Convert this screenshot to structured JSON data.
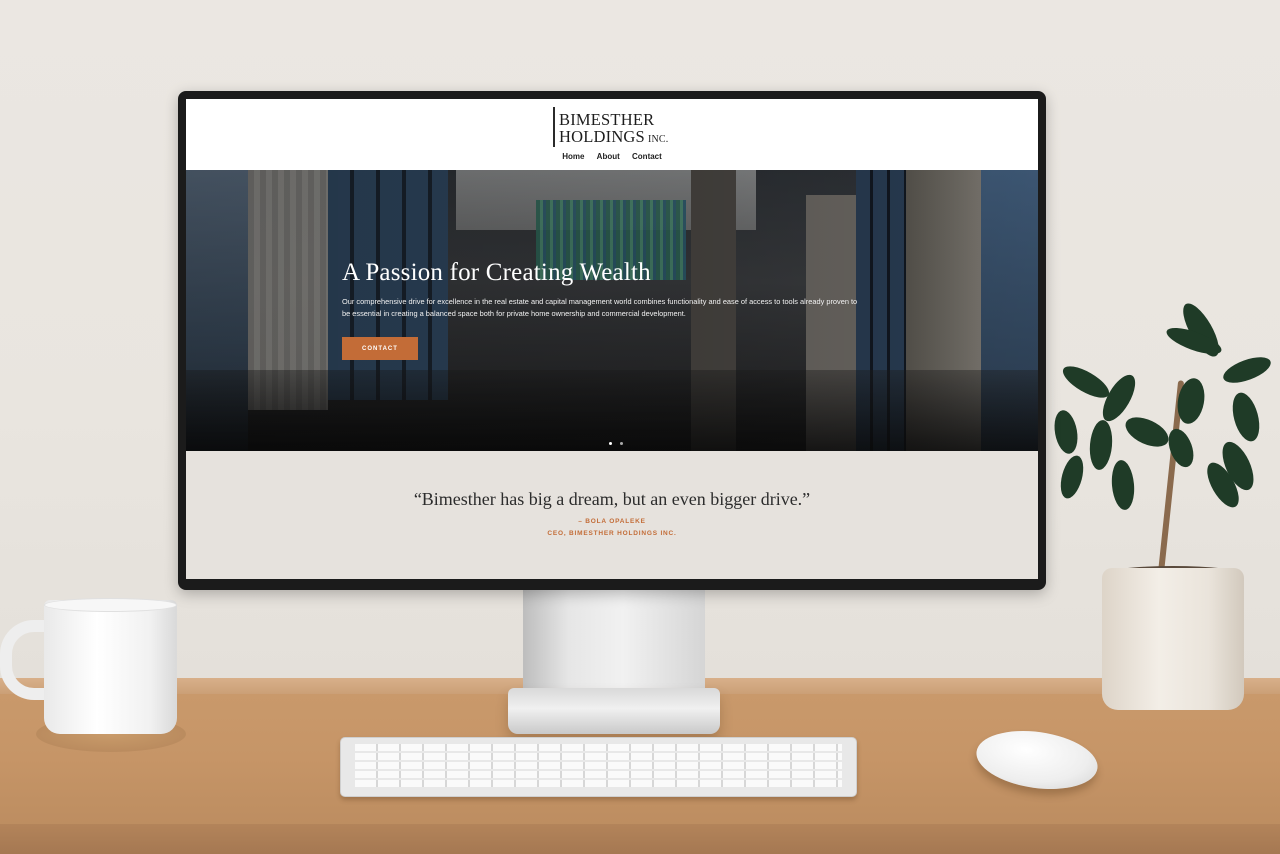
{
  "site": {
    "logo": {
      "line1": "BIMESTHER",
      "line2": "HOLDINGS",
      "suffix": "INC."
    },
    "nav": {
      "items": [
        "Home",
        "About",
        "Contact"
      ]
    },
    "hero": {
      "title": "A Passion for Creating Wealth",
      "description": "Our comprehensive drive for excellence in the real estate and capital management world combines functionality and ease of access to tools already proven to be essential in creating a balanced space both for private home ownership and commercial development.",
      "button_label": "CONTACT",
      "slide_count": 2,
      "active_slide": 1
    },
    "testimonial": {
      "quote": "“Bimesther has big a dream, but an even bigger drive.”",
      "author": "– BOLA OPALEKE",
      "author_title": "CEO, BIMESTHER HOLDINGS INC."
    }
  },
  "colors": {
    "accent": "#c36c37",
    "quote_bg": "#e6e2dd",
    "text_dark": "#2c2c2c"
  }
}
